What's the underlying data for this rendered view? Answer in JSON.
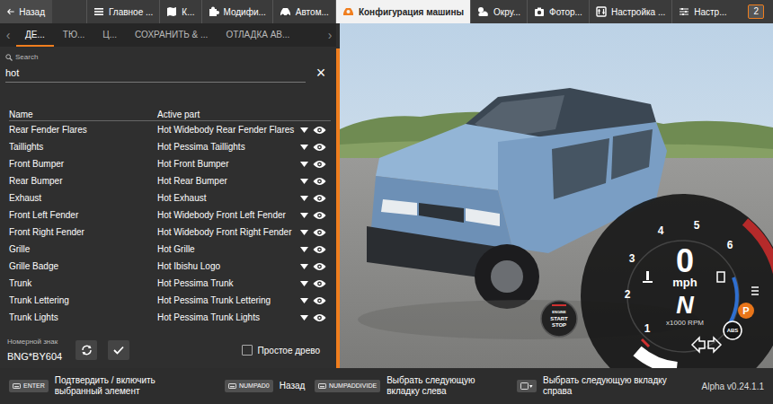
{
  "top_bar": {
    "back": "Назад",
    "tabs": [
      {
        "label": "Главное ...",
        "selected": false
      },
      {
        "label": "К...",
        "selected": false
      },
      {
        "label": "Модифи...",
        "selected": false
      },
      {
        "label": "Автом...",
        "selected": false
      },
      {
        "label": "Конфигурация машины",
        "selected": true
      },
      {
        "label": "Окру...",
        "selected": false
      },
      {
        "label": "Фотор...",
        "selected": false
      },
      {
        "label": "Настройка ...",
        "selected": false
      },
      {
        "label": "Настр...",
        "selected": false
      }
    ],
    "badge": "2"
  },
  "config": {
    "prev": "‹",
    "next": "›",
    "subtabs": [
      {
        "label": "ДЕ...",
        "selected": true
      },
      {
        "label": "ТЮ...",
        "selected": false
      },
      {
        "label": "Ц...",
        "selected": false
      },
      {
        "label": "СОХРАНИТЬ & ...",
        "selected": false
      },
      {
        "label": "ОТЛАДКА АВ...",
        "selected": false
      }
    ],
    "search": {
      "label": "Search",
      "value": "hot",
      "clear": "×"
    },
    "table": {
      "columns": [
        "Name",
        "Active part"
      ],
      "rows": [
        [
          "Rear Fender Flares",
          "Hot Widebody Rear Fender Flares"
        ],
        [
          "Taillights",
          "Hot Pessima Taillights"
        ],
        [
          "Front Bumper",
          "Hot Front Bumper"
        ],
        [
          "Rear Bumper",
          "Hot Rear Bumper"
        ],
        [
          "Exhaust",
          "Hot Exhaust"
        ],
        [
          "Front Left Fender",
          "Hot Widebody Front Left Fender"
        ],
        [
          "Front Right Fender",
          "Hot Widebody Front Right Fender"
        ],
        [
          "Grille",
          "Hot Grille"
        ],
        [
          "Grille Badge",
          "Hot Ibishu Logo"
        ],
        [
          "Trunk",
          "Hot Pessima Trunk"
        ],
        [
          "Trunk Lettering",
          "Hot Pessima Trunk Lettering"
        ],
        [
          "Trunk Lights",
          "Hot Pessima Trunk Lights"
        ]
      ]
    },
    "plate": {
      "label": "Номерной знак",
      "value": "BNG*BY604"
    },
    "simple_tree": {
      "label": "Простое древо",
      "checked": false
    }
  },
  "hud": {
    "speed": "0",
    "unit": "mph",
    "gear": "N",
    "rpm_label": "x1000 RPM",
    "ticks": [
      "1",
      "2",
      "3",
      "4",
      "5",
      "6"
    ],
    "engine_button": [
      "ENGINE",
      "START",
      "STOP"
    ],
    "abs": "ABS",
    "parking": "P"
  },
  "hints": [
    {
      "kind": "key",
      "key": "ENTER",
      "label": "Подтвердить / включить выбранный элемент"
    },
    {
      "kind": "key",
      "key": "NUMPAD0",
      "label": "Назад"
    },
    {
      "kind": "key",
      "key": "NUMPADDIVIDE",
      "label": "Выбрать следующую вкладку слева"
    },
    {
      "kind": "icon",
      "label": "Выбрать следующую вкладку справа"
    }
  ],
  "version": "Alpha v0.24.1.1"
}
